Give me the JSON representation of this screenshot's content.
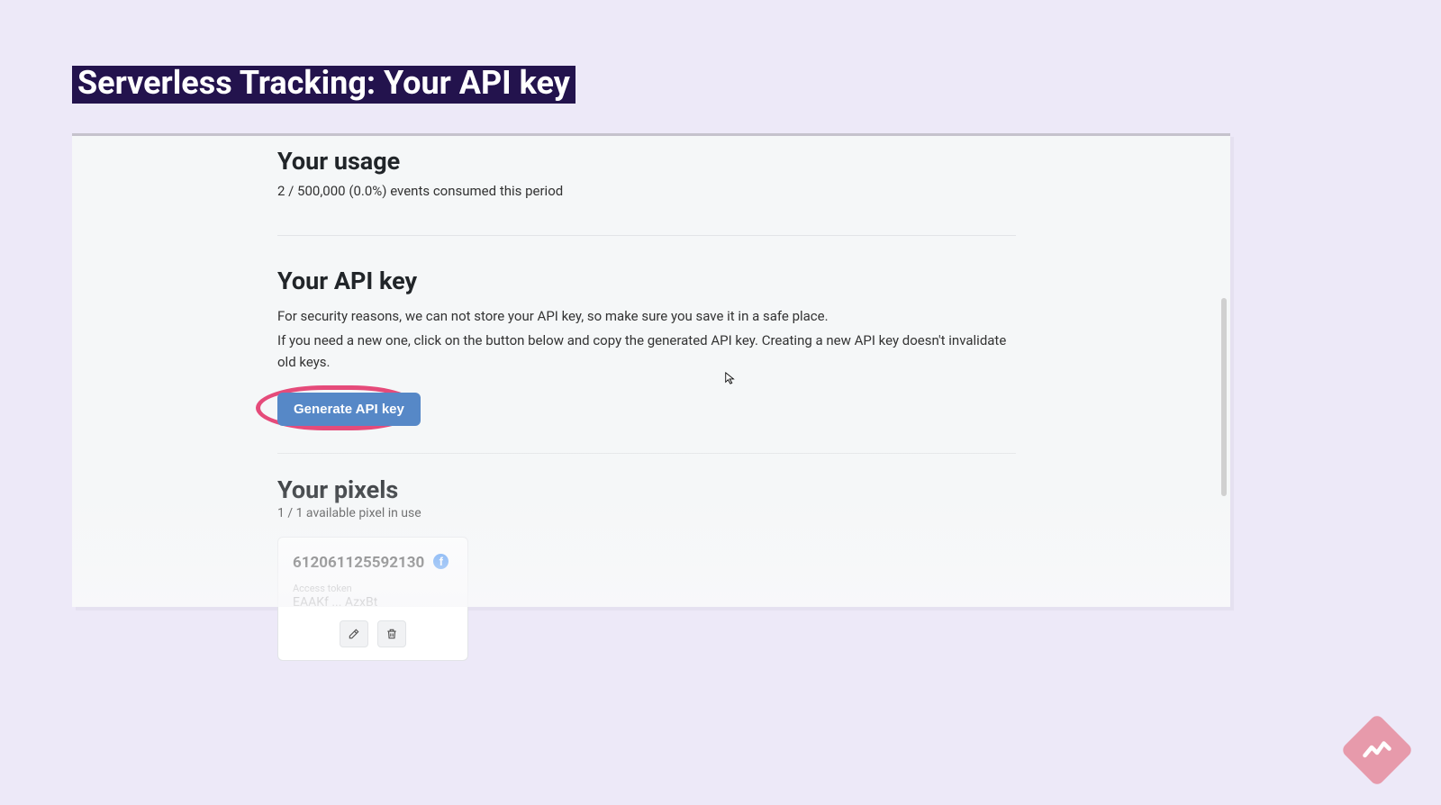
{
  "slide": {
    "title": "Serverless Tracking: Your API key"
  },
  "usage": {
    "heading": "Your usage",
    "line": "2 / 500,000 (0.0%) events consumed this period"
  },
  "api": {
    "heading": "Your API key",
    "p1": "For security reasons, we can not store your API key, so make sure you save it in a safe place.",
    "p2": "If you need a new one, click on the button below and copy the generated API key. Creating a new API key doesn't invalidate old keys.",
    "button": "Generate API key"
  },
  "pixels": {
    "heading": "Your pixels",
    "sub": "1 / 1 available pixel in use",
    "card": {
      "id": "612061125592130",
      "token_label": "Access token",
      "token_value": "EAAKf ... AzxBt"
    }
  }
}
